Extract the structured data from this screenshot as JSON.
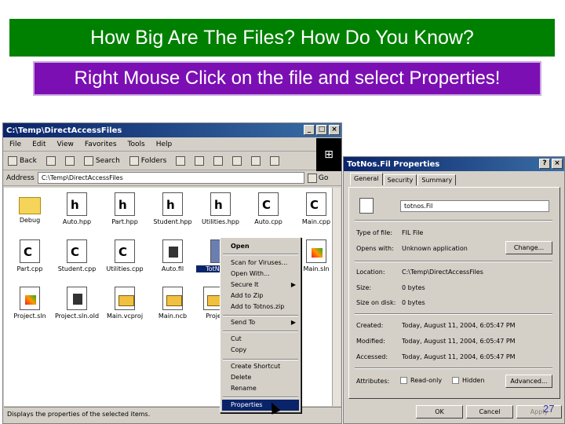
{
  "slide": {
    "title": "How Big Are The Files? How Do You Know?",
    "subtitle": "Right Mouse Click on the file and select Properties!",
    "page_number": "27"
  },
  "explorer": {
    "title": "C:\\Temp\\DirectAccessFiles",
    "menu": [
      "File",
      "Edit",
      "View",
      "Favorites",
      "Tools",
      "Help"
    ],
    "toolbar": {
      "back": "Back",
      "search": "Search",
      "folders": "Folders"
    },
    "address_label": "Address",
    "address_value": "C:\\Temp\\DirectAccessFiles",
    "go_label": "Go",
    "files": [
      {
        "name": "Debug",
        "icon": "folder-icon"
      },
      {
        "name": "Auto.hpp",
        "icon": "header-file-icon"
      },
      {
        "name": "Part.hpp",
        "icon": "header-file-icon"
      },
      {
        "name": "Student.hpp",
        "icon": "header-file-icon"
      },
      {
        "name": "Utilities.hpp",
        "icon": "header-file-icon"
      },
      {
        "name": "Auto.cpp",
        "icon": "cpp-file-icon"
      },
      {
        "name": "Main.cpp",
        "icon": "cpp-file-icon"
      },
      {
        "name": "Part.cpp",
        "icon": "cpp-file-icon"
      },
      {
        "name": "Student.cpp",
        "icon": "cpp-file-icon"
      },
      {
        "name": "Utilities.cpp",
        "icon": "cpp-file-icon"
      },
      {
        "name": "Auto.fil",
        "icon": "data-file-icon"
      },
      {
        "name": "TotNos.Fil",
        "icon": "data-file-icon",
        "selected": true
      },
      {
        "name": "Main.sln",
        "icon": "solution-file-icon"
      },
      {
        "name": "Project.sln",
        "icon": "solution-file-icon"
      },
      {
        "name": "Project.sln.old",
        "icon": "exe-file-icon"
      },
      {
        "name": "Main.vcproj",
        "icon": "project-file-icon"
      },
      {
        "name": "Main.ncb",
        "icon": "project-file-icon"
      },
      {
        "name": "Proje",
        "icon": "project-file-icon"
      }
    ],
    "status": "Displays the properties of the selected items."
  },
  "context_menu": {
    "items": [
      {
        "label": "Open",
        "bold": true
      },
      {
        "label": "Scan for Viruses..."
      },
      {
        "label": "Open With..."
      },
      {
        "label": "Secure It",
        "submenu": true
      },
      {
        "label": "Add to Zip"
      },
      {
        "label": "Add to Totnos.zip"
      },
      {
        "label": "Send To",
        "submenu": true
      },
      {
        "label": "Cut"
      },
      {
        "label": "Copy"
      },
      {
        "label": "Create Shortcut"
      },
      {
        "label": "Delete"
      },
      {
        "label": "Rename"
      },
      {
        "label": "Properties",
        "highlighted": true
      }
    ]
  },
  "properties": {
    "title": "TotNos.Fil Properties",
    "tabs": [
      "General",
      "Security",
      "Summary"
    ],
    "file_name": "totnos.Fil",
    "rows": [
      {
        "label": "Type of file:",
        "value": "FIL File"
      },
      {
        "label": "Opens with:",
        "value": "Unknown application"
      },
      {
        "label": "Location:",
        "value": "C:\\Temp\\DirectAccessFiles"
      },
      {
        "label": "Size:",
        "value": "0 bytes"
      },
      {
        "label": "Size on disk:",
        "value": "0 bytes"
      },
      {
        "label": "Created:",
        "value": "Today, August 11, 2004, 6:05:47 PM"
      },
      {
        "label": "Modified:",
        "value": "Today, August 11, 2004, 6:05:47 PM"
      },
      {
        "label": "Accessed:",
        "value": "Today, August 11, 2004, 6:05:47 PM"
      },
      {
        "label": "Attributes:",
        "value": ""
      }
    ],
    "change_label": "Change...",
    "readonly_label": "Read-only",
    "hidden_label": "Hidden",
    "advanced_label": "Advanced...",
    "ok_label": "OK",
    "cancel_label": "Cancel",
    "apply_label": "Apply"
  },
  "colors": {
    "title_bg": "#008000",
    "subtitle_bg": "#7b0fb3",
    "titlebar": "#0a246a"
  }
}
